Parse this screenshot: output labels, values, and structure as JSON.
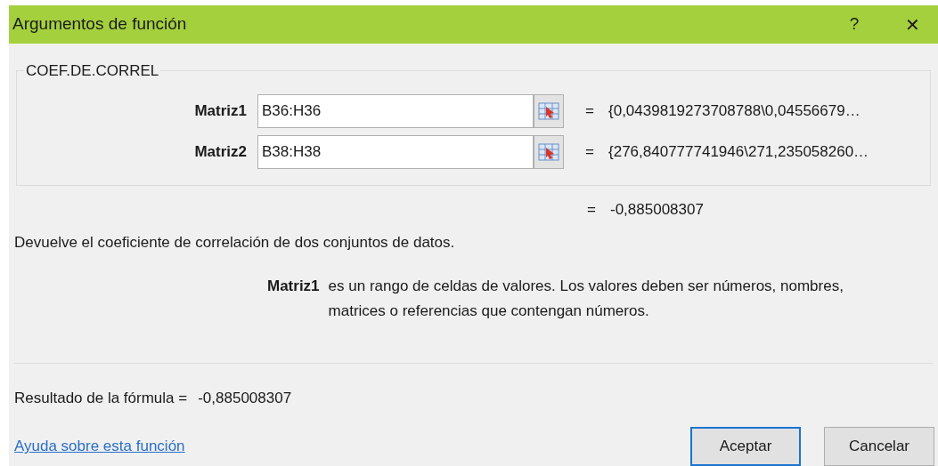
{
  "window": {
    "title": "Argumentos de función",
    "help": "?",
    "close": "✕"
  },
  "function_name": "COEF.DE.CORREL",
  "arguments": [
    {
      "label": "Matriz1",
      "value": "B36:H36",
      "result": "{0,0439819273708788\\0,04556679…"
    },
    {
      "label": "Matriz2",
      "value": "B38:H38",
      "result": "{276,840777741946\\271,235058260…"
    }
  ],
  "function_result": "-0,885008307",
  "equals": "=",
  "description": "Devuelve el coeficiente de correlación de dos conjuntos de datos.",
  "argument_help": {
    "label": "Matriz1",
    "text": "es un rango de celdas de valores. Los valores deben ser números, nombres, matrices o referencias que contengan números."
  },
  "formula_result": {
    "label": "Resultado de la fórmula =",
    "value": "-0,885008307"
  },
  "help_link": "Ayuda sobre esta función",
  "buttons": [
    {
      "label": "Aceptar",
      "default": true
    },
    {
      "label": "Cancelar",
      "default": false
    }
  ]
}
